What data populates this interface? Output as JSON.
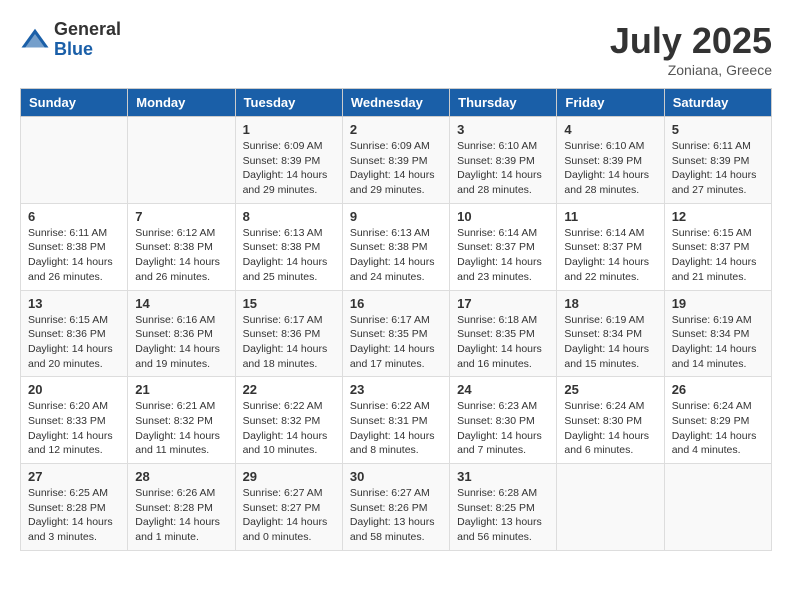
{
  "header": {
    "logo_general": "General",
    "logo_blue": "Blue",
    "month": "July 2025",
    "location": "Zoniana, Greece"
  },
  "weekdays": [
    "Sunday",
    "Monday",
    "Tuesday",
    "Wednesday",
    "Thursday",
    "Friday",
    "Saturday"
  ],
  "weeks": [
    [
      {
        "day": "",
        "sunrise": "",
        "sunset": "",
        "daylight": ""
      },
      {
        "day": "",
        "sunrise": "",
        "sunset": "",
        "daylight": ""
      },
      {
        "day": "1",
        "sunrise": "Sunrise: 6:09 AM",
        "sunset": "Sunset: 8:39 PM",
        "daylight": "Daylight: 14 hours and 29 minutes."
      },
      {
        "day": "2",
        "sunrise": "Sunrise: 6:09 AM",
        "sunset": "Sunset: 8:39 PM",
        "daylight": "Daylight: 14 hours and 29 minutes."
      },
      {
        "day": "3",
        "sunrise": "Sunrise: 6:10 AM",
        "sunset": "Sunset: 8:39 PM",
        "daylight": "Daylight: 14 hours and 28 minutes."
      },
      {
        "day": "4",
        "sunrise": "Sunrise: 6:10 AM",
        "sunset": "Sunset: 8:39 PM",
        "daylight": "Daylight: 14 hours and 28 minutes."
      },
      {
        "day": "5",
        "sunrise": "Sunrise: 6:11 AM",
        "sunset": "Sunset: 8:39 PM",
        "daylight": "Daylight: 14 hours and 27 minutes."
      }
    ],
    [
      {
        "day": "6",
        "sunrise": "Sunrise: 6:11 AM",
        "sunset": "Sunset: 8:38 PM",
        "daylight": "Daylight: 14 hours and 26 minutes."
      },
      {
        "day": "7",
        "sunrise": "Sunrise: 6:12 AM",
        "sunset": "Sunset: 8:38 PM",
        "daylight": "Daylight: 14 hours and 26 minutes."
      },
      {
        "day": "8",
        "sunrise": "Sunrise: 6:13 AM",
        "sunset": "Sunset: 8:38 PM",
        "daylight": "Daylight: 14 hours and 25 minutes."
      },
      {
        "day": "9",
        "sunrise": "Sunrise: 6:13 AM",
        "sunset": "Sunset: 8:38 PM",
        "daylight": "Daylight: 14 hours and 24 minutes."
      },
      {
        "day": "10",
        "sunrise": "Sunrise: 6:14 AM",
        "sunset": "Sunset: 8:37 PM",
        "daylight": "Daylight: 14 hours and 23 minutes."
      },
      {
        "day": "11",
        "sunrise": "Sunrise: 6:14 AM",
        "sunset": "Sunset: 8:37 PM",
        "daylight": "Daylight: 14 hours and 22 minutes."
      },
      {
        "day": "12",
        "sunrise": "Sunrise: 6:15 AM",
        "sunset": "Sunset: 8:37 PM",
        "daylight": "Daylight: 14 hours and 21 minutes."
      }
    ],
    [
      {
        "day": "13",
        "sunrise": "Sunrise: 6:15 AM",
        "sunset": "Sunset: 8:36 PM",
        "daylight": "Daylight: 14 hours and 20 minutes."
      },
      {
        "day": "14",
        "sunrise": "Sunrise: 6:16 AM",
        "sunset": "Sunset: 8:36 PM",
        "daylight": "Daylight: 14 hours and 19 minutes."
      },
      {
        "day": "15",
        "sunrise": "Sunrise: 6:17 AM",
        "sunset": "Sunset: 8:36 PM",
        "daylight": "Daylight: 14 hours and 18 minutes."
      },
      {
        "day": "16",
        "sunrise": "Sunrise: 6:17 AM",
        "sunset": "Sunset: 8:35 PM",
        "daylight": "Daylight: 14 hours and 17 minutes."
      },
      {
        "day": "17",
        "sunrise": "Sunrise: 6:18 AM",
        "sunset": "Sunset: 8:35 PM",
        "daylight": "Daylight: 14 hours and 16 minutes."
      },
      {
        "day": "18",
        "sunrise": "Sunrise: 6:19 AM",
        "sunset": "Sunset: 8:34 PM",
        "daylight": "Daylight: 14 hours and 15 minutes."
      },
      {
        "day": "19",
        "sunrise": "Sunrise: 6:19 AM",
        "sunset": "Sunset: 8:34 PM",
        "daylight": "Daylight: 14 hours and 14 minutes."
      }
    ],
    [
      {
        "day": "20",
        "sunrise": "Sunrise: 6:20 AM",
        "sunset": "Sunset: 8:33 PM",
        "daylight": "Daylight: 14 hours and 12 minutes."
      },
      {
        "day": "21",
        "sunrise": "Sunrise: 6:21 AM",
        "sunset": "Sunset: 8:32 PM",
        "daylight": "Daylight: 14 hours and 11 minutes."
      },
      {
        "day": "22",
        "sunrise": "Sunrise: 6:22 AM",
        "sunset": "Sunset: 8:32 PM",
        "daylight": "Daylight: 14 hours and 10 minutes."
      },
      {
        "day": "23",
        "sunrise": "Sunrise: 6:22 AM",
        "sunset": "Sunset: 8:31 PM",
        "daylight": "Daylight: 14 hours and 8 minutes."
      },
      {
        "day": "24",
        "sunrise": "Sunrise: 6:23 AM",
        "sunset": "Sunset: 8:30 PM",
        "daylight": "Daylight: 14 hours and 7 minutes."
      },
      {
        "day": "25",
        "sunrise": "Sunrise: 6:24 AM",
        "sunset": "Sunset: 8:30 PM",
        "daylight": "Daylight: 14 hours and 6 minutes."
      },
      {
        "day": "26",
        "sunrise": "Sunrise: 6:24 AM",
        "sunset": "Sunset: 8:29 PM",
        "daylight": "Daylight: 14 hours and 4 minutes."
      }
    ],
    [
      {
        "day": "27",
        "sunrise": "Sunrise: 6:25 AM",
        "sunset": "Sunset: 8:28 PM",
        "daylight": "Daylight: 14 hours and 3 minutes."
      },
      {
        "day": "28",
        "sunrise": "Sunrise: 6:26 AM",
        "sunset": "Sunset: 8:28 PM",
        "daylight": "Daylight: 14 hours and 1 minute."
      },
      {
        "day": "29",
        "sunrise": "Sunrise: 6:27 AM",
        "sunset": "Sunset: 8:27 PM",
        "daylight": "Daylight: 14 hours and 0 minutes."
      },
      {
        "day": "30",
        "sunrise": "Sunrise: 6:27 AM",
        "sunset": "Sunset: 8:26 PM",
        "daylight": "Daylight: 13 hours and 58 minutes."
      },
      {
        "day": "31",
        "sunrise": "Sunrise: 6:28 AM",
        "sunset": "Sunset: 8:25 PM",
        "daylight": "Daylight: 13 hours and 56 minutes."
      },
      {
        "day": "",
        "sunrise": "",
        "sunset": "",
        "daylight": ""
      },
      {
        "day": "",
        "sunrise": "",
        "sunset": "",
        "daylight": ""
      }
    ]
  ]
}
